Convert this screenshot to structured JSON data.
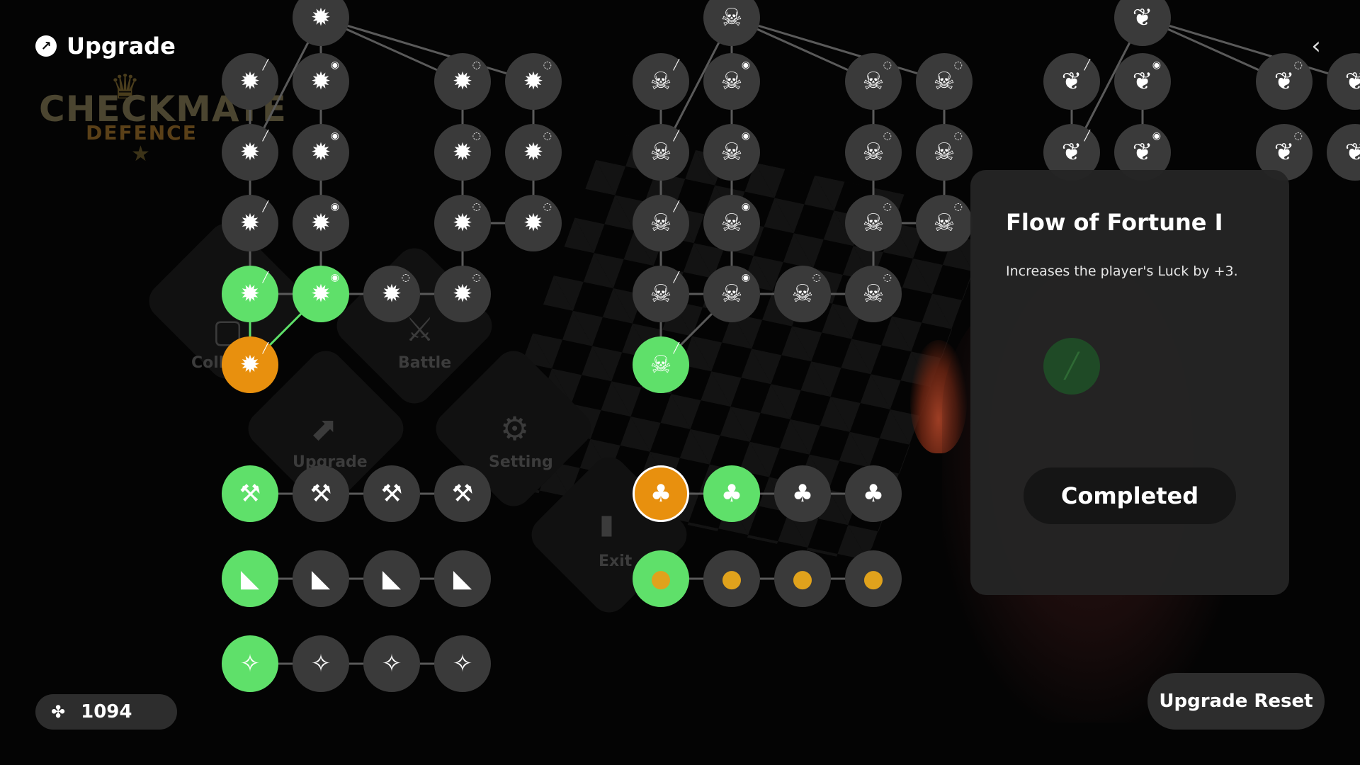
{
  "header": {
    "title": "Upgrade",
    "icon": "upgrade-trend-icon"
  },
  "logo": {
    "line1": "CHECKMATE",
    "line2": "DEFENCE"
  },
  "background_menu": {
    "collection_label": "Coll",
    "battle_label": "Battle",
    "upgrade_label": "Upgrade",
    "setting_label": "Setting",
    "exit_label": "Exit"
  },
  "info_panel": {
    "title": "Flow of Fortune I",
    "description": "Increases the player's Luck by +3.",
    "status_label": "Completed"
  },
  "currency": {
    "value": "1094",
    "icon": "puzzle-piece-icon"
  },
  "reset_button_label": "Upgrade Reset",
  "colors": {
    "completed": "#5fe06a",
    "selected": "#e8900e",
    "locked": "#3a3a3a",
    "coin": "#e0a21c"
  },
  "skill_nodes": {
    "flame_tree": {
      "icon": "flame-burst-icon",
      "completed_count": 3,
      "selected": "chain-1-tier-5"
    },
    "skull_tree": {
      "icon": "horned-skull-icon",
      "completed_count": 1
    },
    "wing_tree": {
      "icon": "winged-emblem-icon"
    },
    "strength_row": {
      "icon": "dumbbell-icon",
      "completed_count": 1
    },
    "speed_row": {
      "icon": "sneaker-icon",
      "completed_count": 1
    },
    "magic_row": {
      "icon": "magic-wand-icon",
      "completed_count": 1
    },
    "luck_row": {
      "icon": "clover-icon",
      "completed_count": 1,
      "selected": "luck-1"
    },
    "coin_row": {
      "icon": "coin-icon",
      "completed_count": 1
    }
  }
}
